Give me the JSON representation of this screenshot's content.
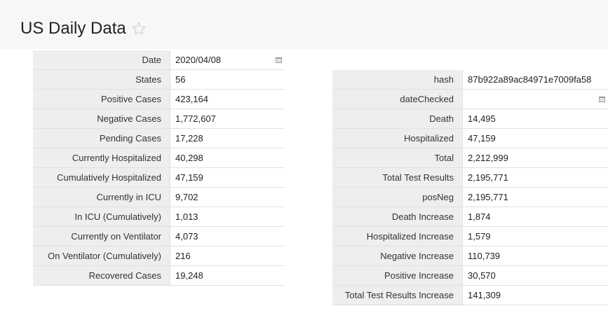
{
  "page": {
    "title": "US Daily Data"
  },
  "left_record": [
    {
      "label": "Date",
      "value": "2020/04/08",
      "has_calendar": true
    },
    {
      "label": "States",
      "value": "56"
    },
    {
      "label": "Positive Cases",
      "value": "423,164"
    },
    {
      "label": "Negative Cases",
      "value": "1,772,607"
    },
    {
      "label": "Pending Cases",
      "value": "17,228"
    },
    {
      "label": "Currently Hospitalized",
      "value": "40,298"
    },
    {
      "label": "Cumulatively Hospitalized",
      "value": "47,159"
    },
    {
      "label": "Currently in ICU",
      "value": "9,702"
    },
    {
      "label": "In ICU (Cumulatively)",
      "value": "1,013"
    },
    {
      "label": "Currently on Ventilator",
      "value": "4,073"
    },
    {
      "label": "On Ventilator (Cumulatively)",
      "value": "216"
    },
    {
      "label": "Recovered Cases",
      "value": "19,248"
    }
  ],
  "right_record": [
    {
      "label": "hash",
      "value": "87b922a89ac84971e7009fa58"
    },
    {
      "label": "dateChecked",
      "value": "",
      "has_calendar": true
    },
    {
      "label": "Death",
      "value": "14,495"
    },
    {
      "label": "Hospitalized",
      "value": "47,159"
    },
    {
      "label": "Total",
      "value": "2,212,999"
    },
    {
      "label": "Total Test Results",
      "value": "2,195,771"
    },
    {
      "label": "posNeg",
      "value": "2,195,771"
    },
    {
      "label": "Death Increase",
      "value": "1,874"
    },
    {
      "label": "Hospitalized Increase",
      "value": "1,579"
    },
    {
      "label": "Negative Increase",
      "value": "110,739"
    },
    {
      "label": "Positive Increase",
      "value": "30,570"
    },
    {
      "label": "Total Test Results Increase",
      "value": "141,309"
    }
  ],
  "icons": {
    "favorite": "star-icon",
    "date_picker": "calendar-icon"
  },
  "colors": {
    "label_bg": "#eeeeee",
    "border": "#e1e1e1",
    "star": "#d4d4d4"
  }
}
